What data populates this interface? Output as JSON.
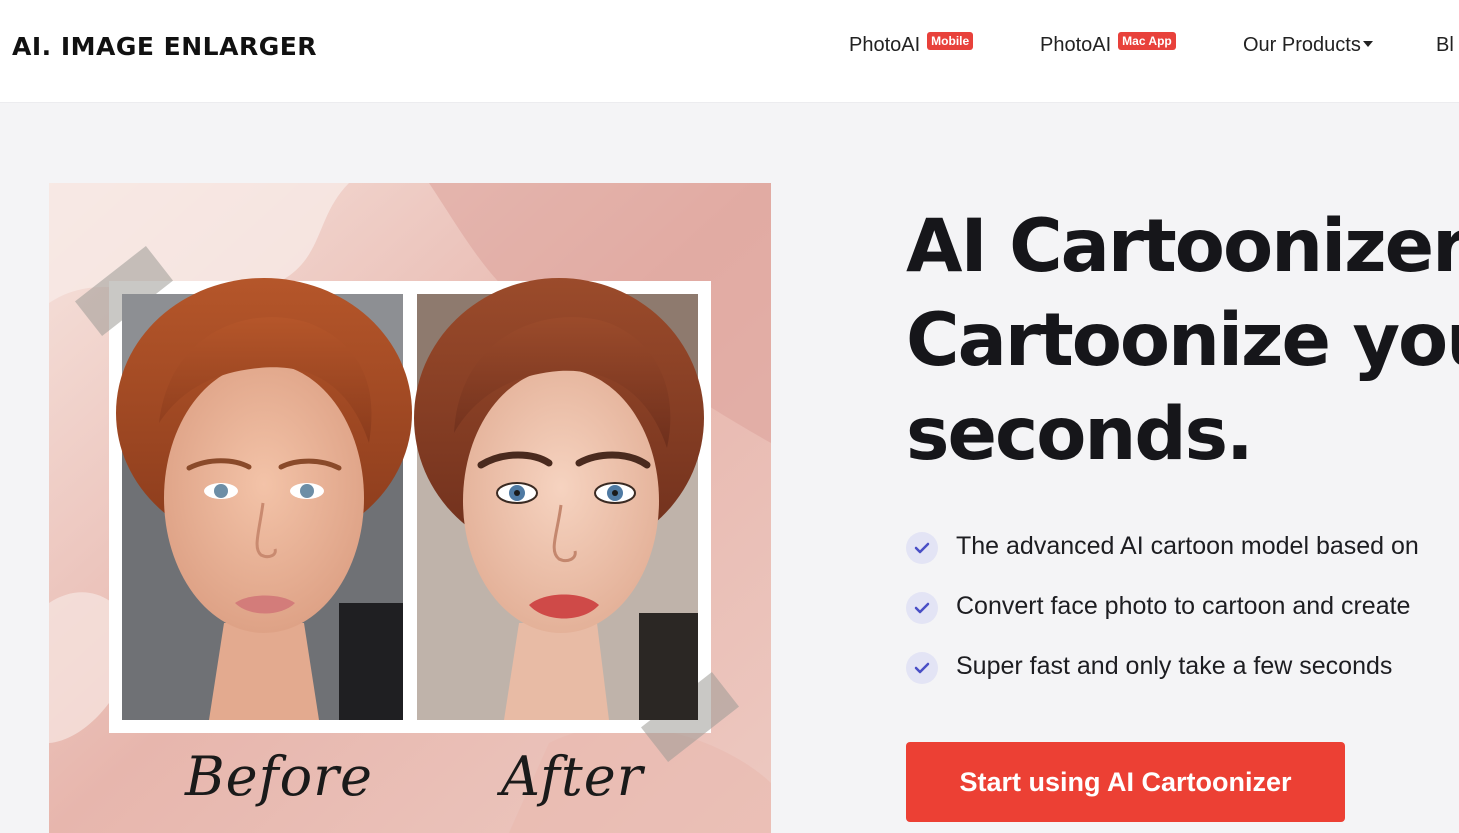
{
  "header": {
    "logo": "AI. IMAGE ENLARGER",
    "nav": [
      {
        "label": "PhotoAI",
        "badge": "Mobile"
      },
      {
        "label": "PhotoAI",
        "badge": "Mac App"
      },
      {
        "label": "Our Products"
      },
      {
        "label": "Bl"
      }
    ]
  },
  "hero": {
    "title_lines": [
      "AI Cartoonizer",
      "Cartoonize yours",
      "seconds."
    ],
    "features": [
      "The advanced AI cartoon model based on",
      "Convert face photo to cartoon and create",
      "Super fast and only take a few seconds"
    ],
    "cta_label": "Start using AI Cartoonizer",
    "image": {
      "before_caption": "Before",
      "after_caption": "After"
    }
  },
  "colors": {
    "accent": "#ec4034",
    "badge": "#e8413b",
    "check_bg": "#e3e4f5",
    "check_mark": "#4a4fc6",
    "page_bg": "#f4f4f6"
  }
}
